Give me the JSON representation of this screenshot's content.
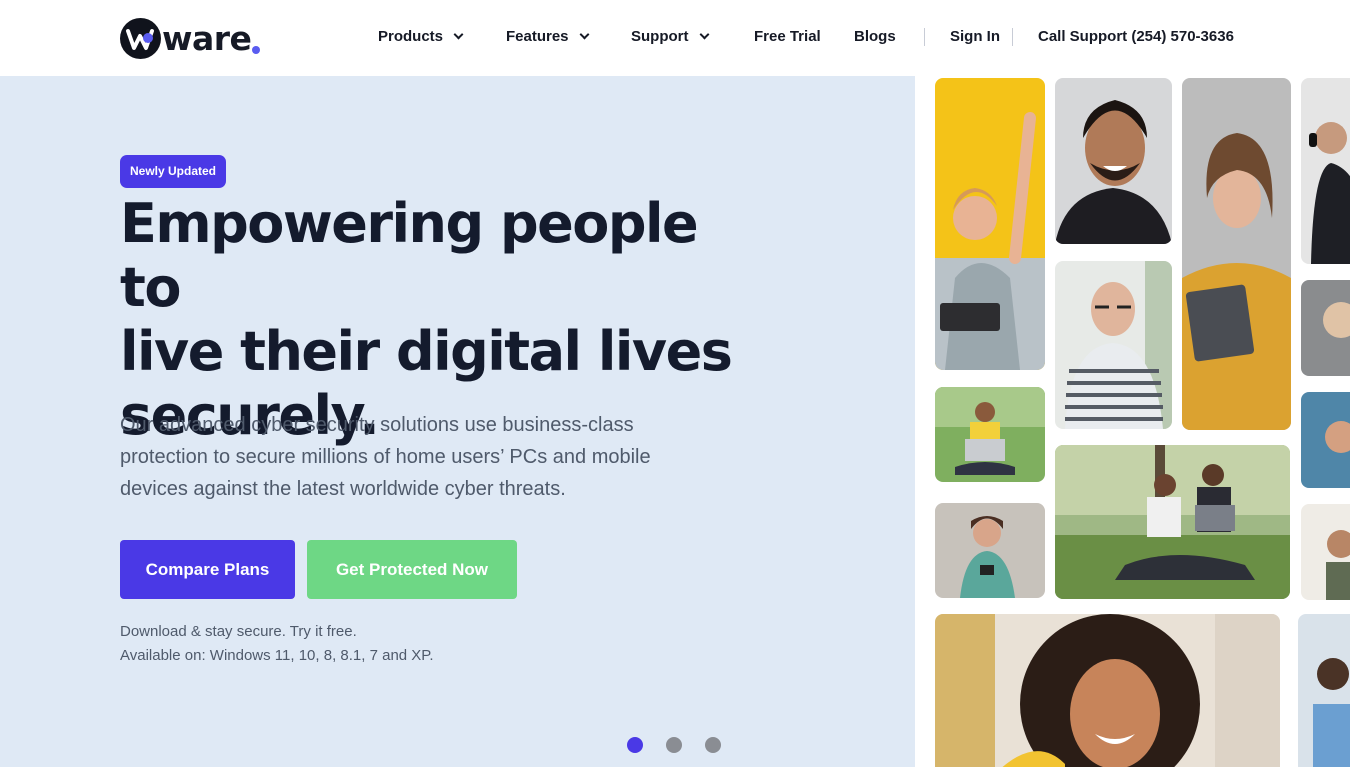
{
  "brand": {
    "name": "ware",
    "accent": "#4a39e6",
    "green": "#6ed785"
  },
  "nav": {
    "products": "Products",
    "features": "Features",
    "support": "Support",
    "free_trial": "Free Trial",
    "blogs": "Blogs",
    "sign_in": "Sign In",
    "call_support": "Call Support (254) 570-3636"
  },
  "hero": {
    "badge": "Newly Updated",
    "headline_1": "Empowering people to",
    "headline_2": "live their digital lives",
    "headline_3": "securely.",
    "description": "Our advanced cyber security solutions use business-class protection to secure millions of home users’ PCs and mobile devices against the latest worldwide cyber threats.",
    "compare_plans": "Compare Plans",
    "get_protected": "Get Protected Now",
    "note_1": "Download & stay secure. Try it free.",
    "note_2": "Available on: Windows 11, 10, 8, 8.1, 7 and XP."
  },
  "carousel": {
    "slides": 3,
    "active": 1
  }
}
